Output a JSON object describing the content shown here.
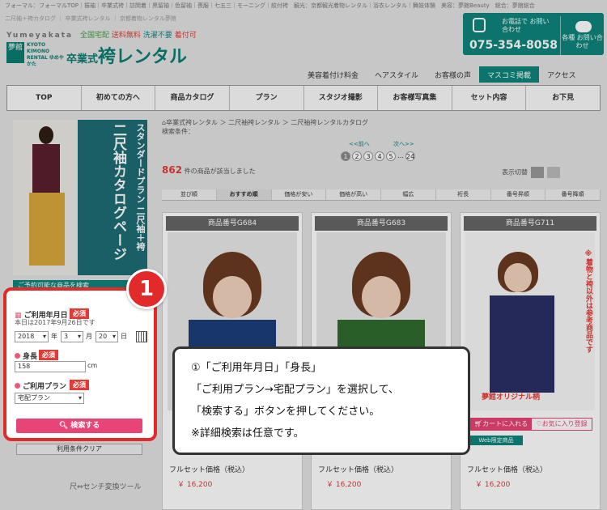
{
  "header": {
    "crumbs": "フォーマル：フォーマルTOP｜振袖｜卒業式袴｜訪問着｜黒留袖｜色留袖｜喪服｜七五三｜モーニング｜紋付袴　観光：京都観光着物レンタル｜浴衣レンタル｜舞妓体験　美容：夢館Beauty　総合：夢館総合",
    "crumbs2": "二尺袖＋袴カタログ ｜ 卒業式袴レンタル ｜ 京都着物レンタル夢館",
    "brand_tag": "Yumeyakata",
    "brand_points": [
      "全国宅配",
      "送料無料",
      "洗濯不要",
      "着付可"
    ],
    "logo_mark": "夢館",
    "logo_en": "KYOTO KIMONO RENTAL ゆめやかた",
    "logo_small": "卒業式",
    "logo_main": "袴レンタル",
    "phone_label": "お電話で お問い合わせ",
    "phone": "075-354-8058",
    "mail_label": "各種 お問い合わせ"
  },
  "subnav": [
    "美容着付け料金",
    "ヘアスタイル",
    "お客様の声",
    "マスコミ掲載",
    "アクセス"
  ],
  "mainnav": [
    "TOP",
    "初めての方へ",
    "商品カタログ",
    "プラン",
    "スタジオ撮影",
    "お客様写真集",
    "セット内容",
    "お下見"
  ],
  "banner": {
    "line1": "スタンダードプラン 二尺袖＋袴",
    "line2": "二尺袖カタログページ"
  },
  "search": {
    "head": "ご予約可能な商品を検索",
    "date_label": "ご利用年月日",
    "required": "必須",
    "date_sub": "本日は2017年9月26日です",
    "year": "2018",
    "year_unit": "年",
    "month": "3",
    "month_unit": "月",
    "day": "20",
    "day_unit": "日",
    "height_label": "身長",
    "height_value": "158",
    "height_unit": "cm",
    "plan_label": "ご利用プラン",
    "plan_value": "宅配プラン",
    "search_button": "検索する",
    "clear_button": "利用条件クリア",
    "tool_link": "尺⇔センチ変換ツール",
    "step_number": "1"
  },
  "content": {
    "breadcrumb": "卒業式袴レンタル ＞ 二尺袖袴レンタル ＞ 二尺袖袴レンタルカタログ",
    "conditions": "検索条件：",
    "prev": "<<前へ",
    "next": "次へ>>",
    "pages": [
      "1",
      "2",
      "3",
      "4",
      "5",
      "…",
      "24"
    ],
    "count": "862",
    "count_suffix": "件の商品が該当しました",
    "view_switch": "表示切替",
    "sort_label": "並び順",
    "sort_options": [
      "おすすめ順",
      "価格が安い",
      "価格が高い",
      "幅広",
      "裄長",
      "番号昇順",
      "番号降順"
    ]
  },
  "products": [
    {
      "code": "商品番号G684",
      "price_label": "フルセット価格（税込）",
      "price": "￥ 16,200"
    },
    {
      "code": "商品番号G683",
      "price_label": "フルセット価格（税込）",
      "price": "￥ 16,200"
    },
    {
      "code": "商品番号G711",
      "price_label": "フルセット価格（税込）",
      "price": "￥ 16,200",
      "title": "夢館オリジナル柄",
      "note": "※着物と袴以外は参考商品です",
      "cart": "カートに入れる",
      "fav": "お気に入り登録",
      "web": "Web限定商品"
    }
  ],
  "callout": {
    "line1": "①「ご利用年月日」「身長」",
    "line2": "「ご利用プラン→宅配プラン」を選択して、",
    "line3": "「検索する」ボタンを押してください。",
    "line4": "※詳細検索は任意です。"
  },
  "colors": {
    "brand": "#0e857b",
    "accent": "#e84475",
    "highlight": "#e32a2a"
  }
}
